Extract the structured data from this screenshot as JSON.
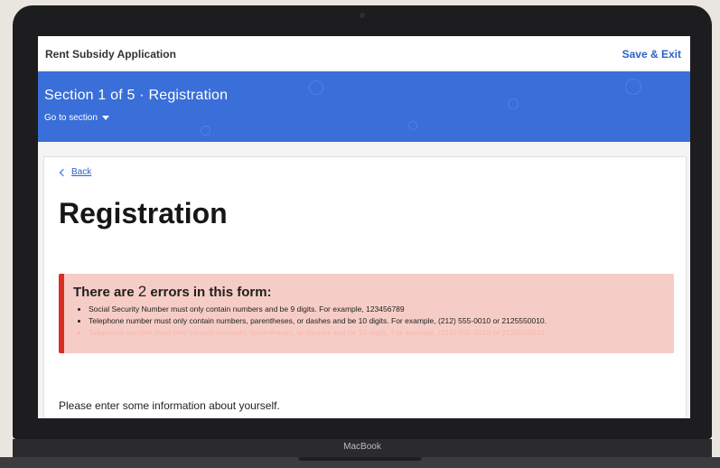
{
  "device": {
    "brand_label": "MacBook"
  },
  "header": {
    "app_title": "Rent Subsidy Application",
    "save_exit_label": "Save & Exit"
  },
  "banner": {
    "title": "Section 1 of 5 · Registration",
    "goto_label": "Go to section",
    "color": "#3a6ed8"
  },
  "main": {
    "back_label": "Back",
    "page_title": "Registration",
    "errors": {
      "heading_prefix": "There are ",
      "count": "2",
      "heading_suffix": " errors in this form:",
      "items": [
        "Social Security Number must only contain numbers and be 9 digits. For example, 123456789",
        "Telephone number must only contain numbers, parentheses, or dashes and be 10 digits. For example, (212) 555-0010 or 2125550010.",
        "Telephone number must only contain numbers, parentheses, or dashes and be 10 digits. For example, (212) 555-0010 or 2125550010."
      ],
      "accent": "#da2d24",
      "background": "#f6cdc6"
    },
    "intro_text": "Please enter some information about yourself."
  }
}
